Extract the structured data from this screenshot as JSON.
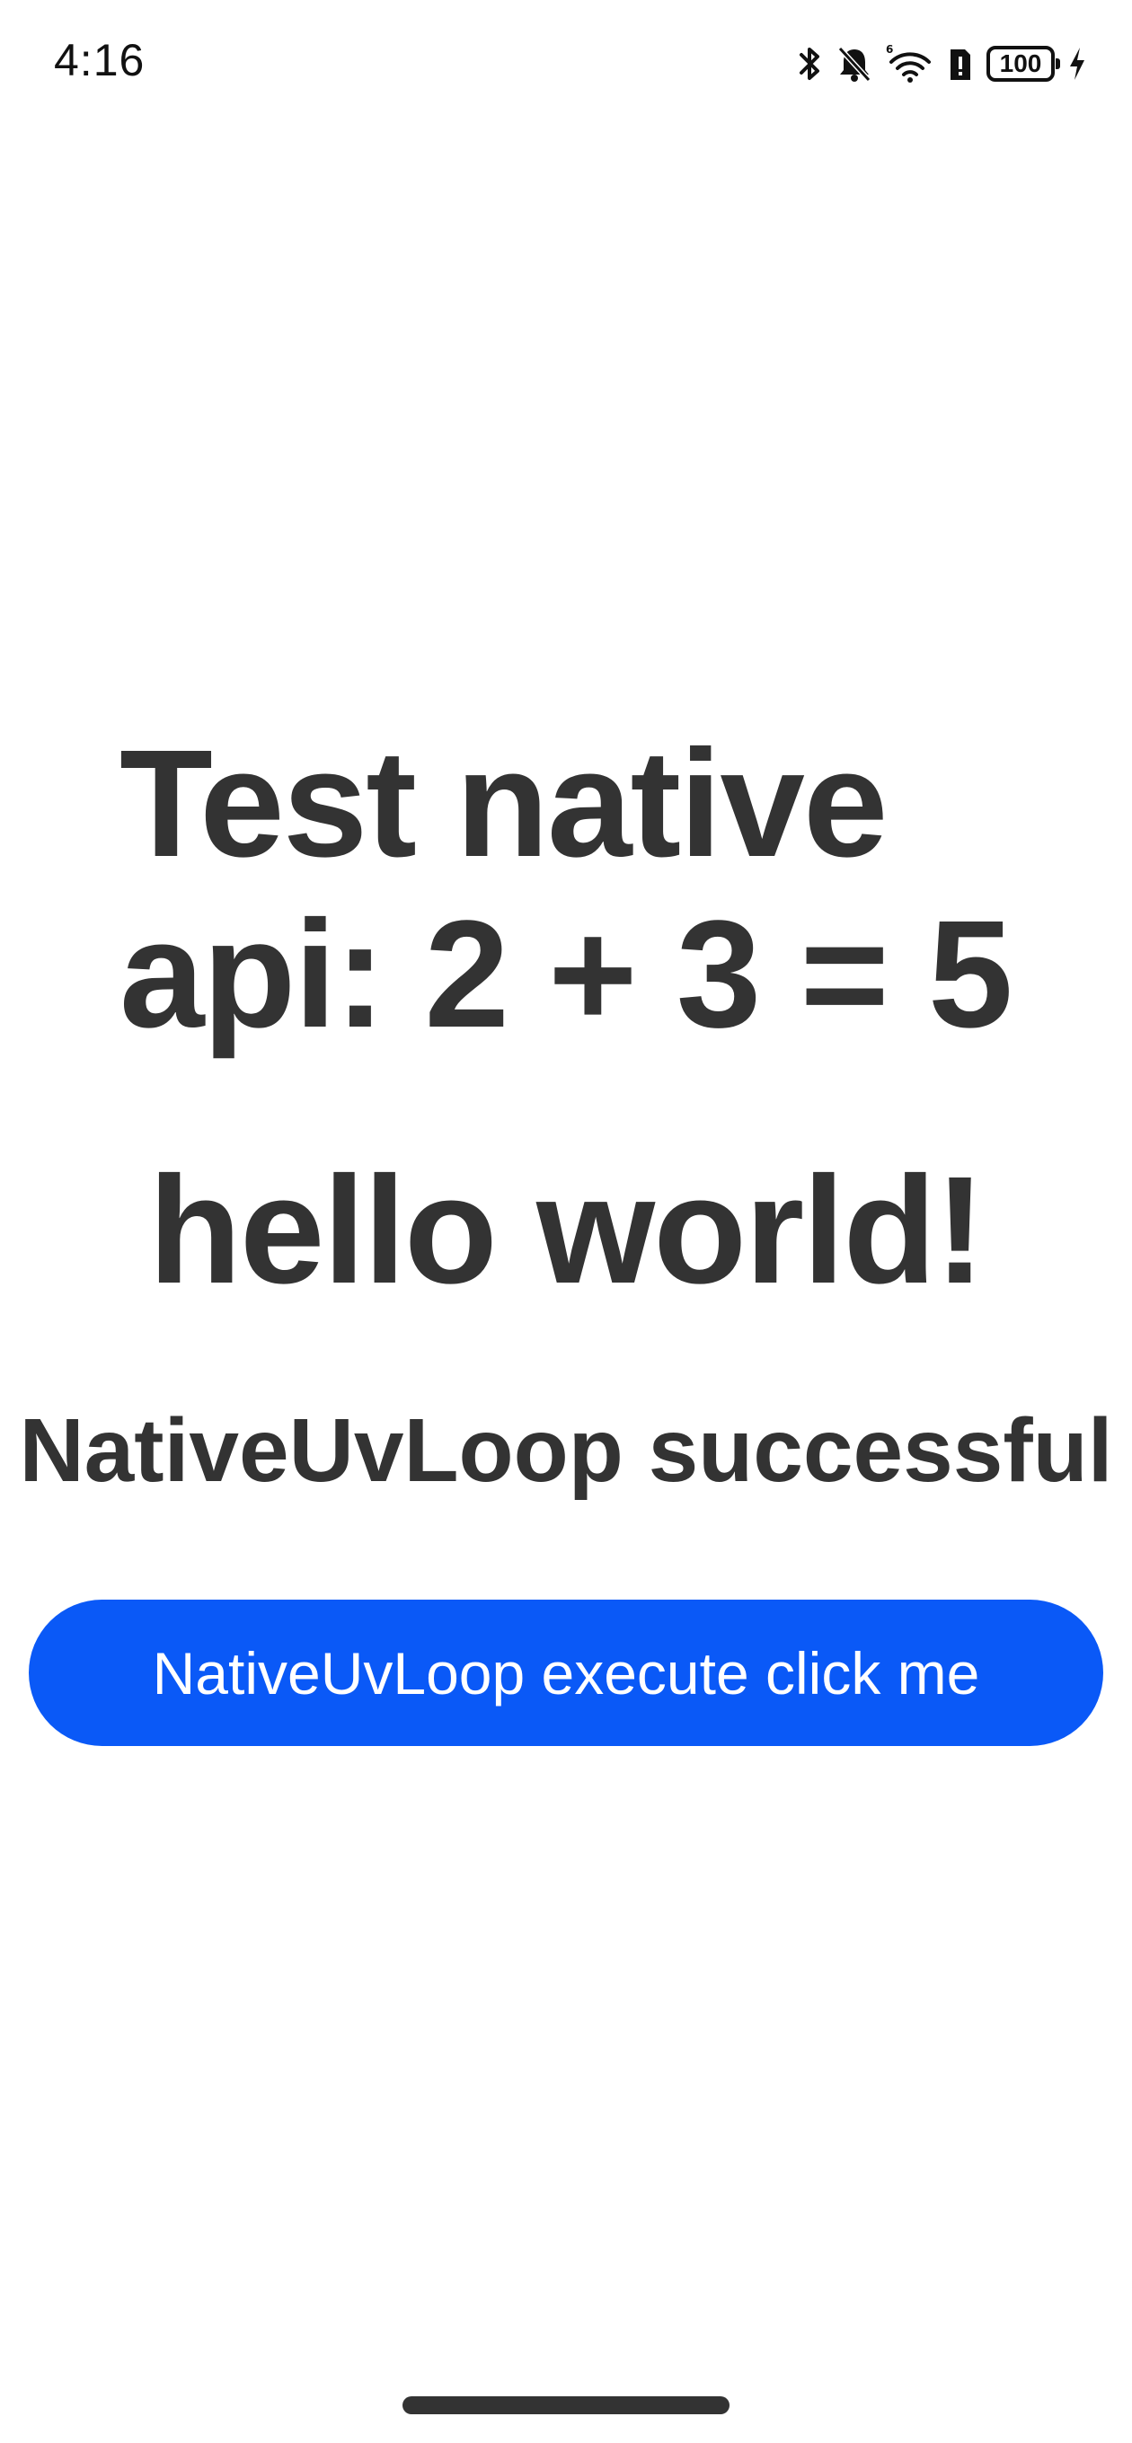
{
  "status_bar": {
    "time": "4:16",
    "battery_level": "100",
    "icons": [
      "bluetooth-icon",
      "bell-muted-icon",
      "wifi-6-icon",
      "sim-alert-icon",
      "battery-icon",
      "charging-bolt-icon"
    ]
  },
  "main": {
    "title": "Test native api: 2 + 3 = 5",
    "greeting": "hello world!",
    "status_message": "NativeUvLoop successful",
    "action_button_label": "NativeUvLoop execute click me"
  },
  "colors": {
    "background": "#ffffff",
    "text": "#333333",
    "button": "#0a59f7",
    "button_text": "#ffffff"
  }
}
